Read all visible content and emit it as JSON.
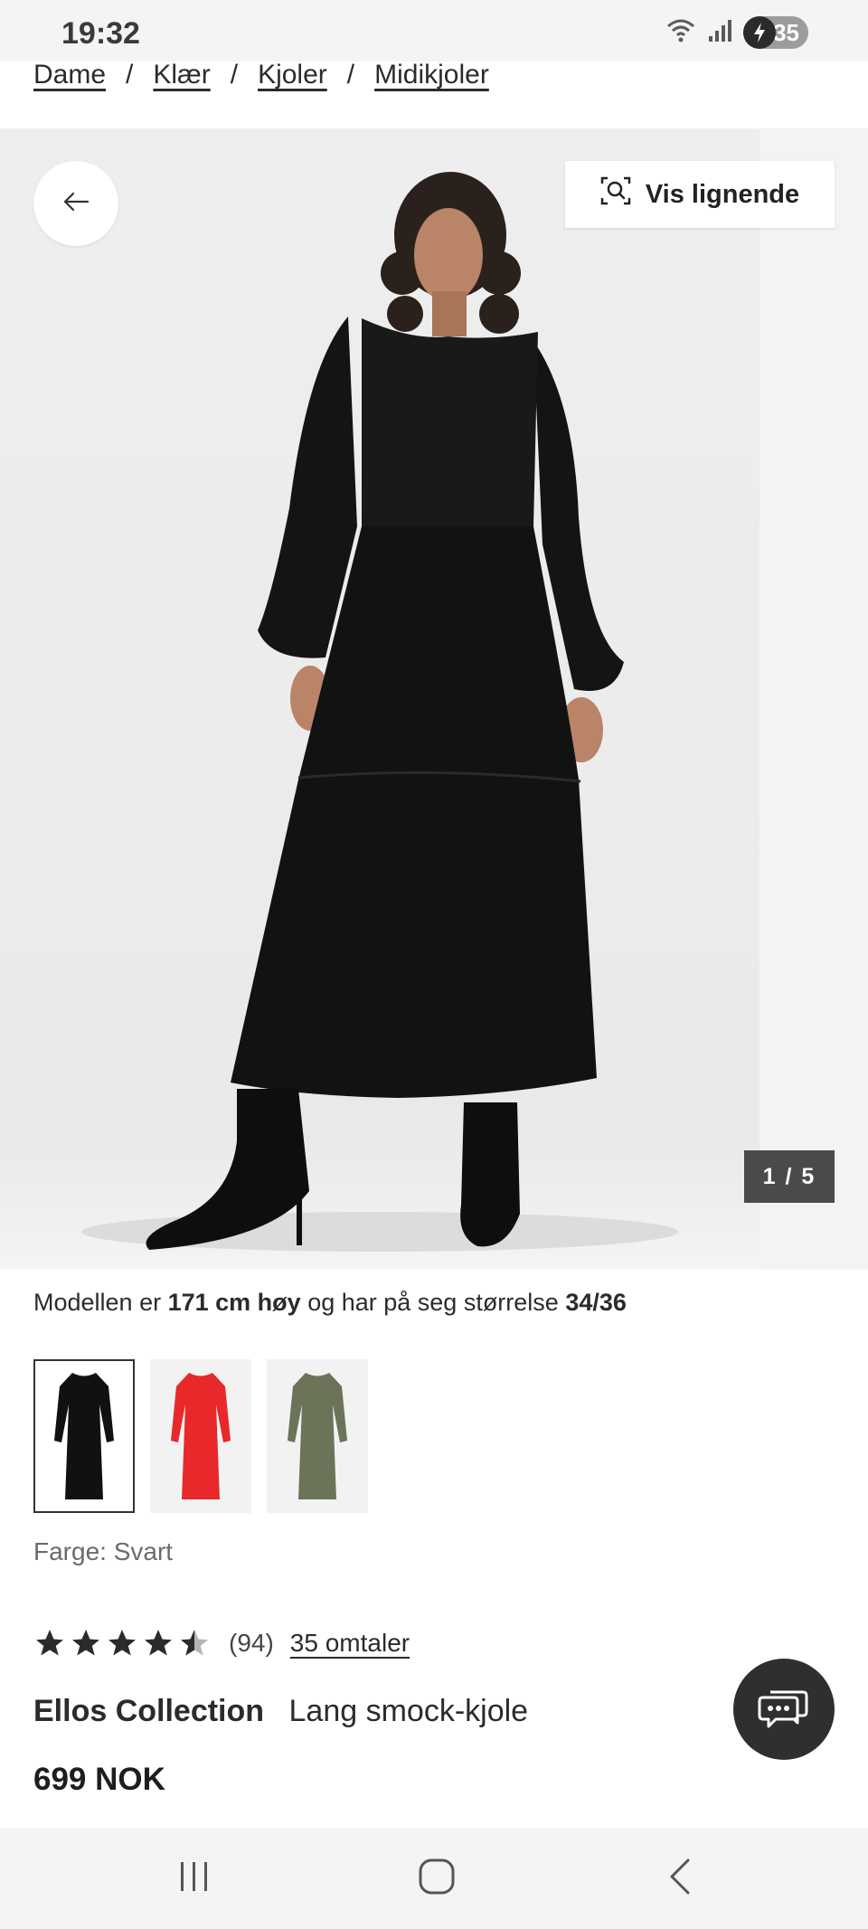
{
  "status_bar": {
    "time": "19:32",
    "battery_level": "35",
    "icons": [
      "wifi-icon",
      "signal-icon",
      "battery-charging-icon"
    ]
  },
  "breadcrumb": [
    "Dame",
    "Klær",
    "Kjoler",
    "Midikjoler"
  ],
  "breadcrumb_separator": "/",
  "gallery": {
    "similar_button_label": "Vis lignende",
    "image_counter": "1 / 5",
    "current_image": 1,
    "total_images": 5
  },
  "model_info": {
    "prefix": "Modellen er",
    "height": "171 cm høy",
    "middle": "og har på seg størrelse",
    "size": "34/36"
  },
  "swatches": [
    {
      "color_name": "black",
      "hex": "#111111",
      "selected": true
    },
    {
      "color_name": "red",
      "hex": "#e8282a",
      "selected": false
    },
    {
      "color_name": "green",
      "hex": "#6b7458",
      "selected": false
    }
  ],
  "color_label": "Farge: Svart",
  "rating": {
    "stars": 4.5,
    "count_text": "(94)",
    "reviews_link": "35 omtaler"
  },
  "product": {
    "brand": "Ellos Collection",
    "name": "Lang smock-kjole",
    "price": "699 NOK"
  },
  "colors": {
    "accent_dark": "#2f2f2f",
    "text": "#2b2b2b",
    "muted": "#6b6b6b"
  }
}
